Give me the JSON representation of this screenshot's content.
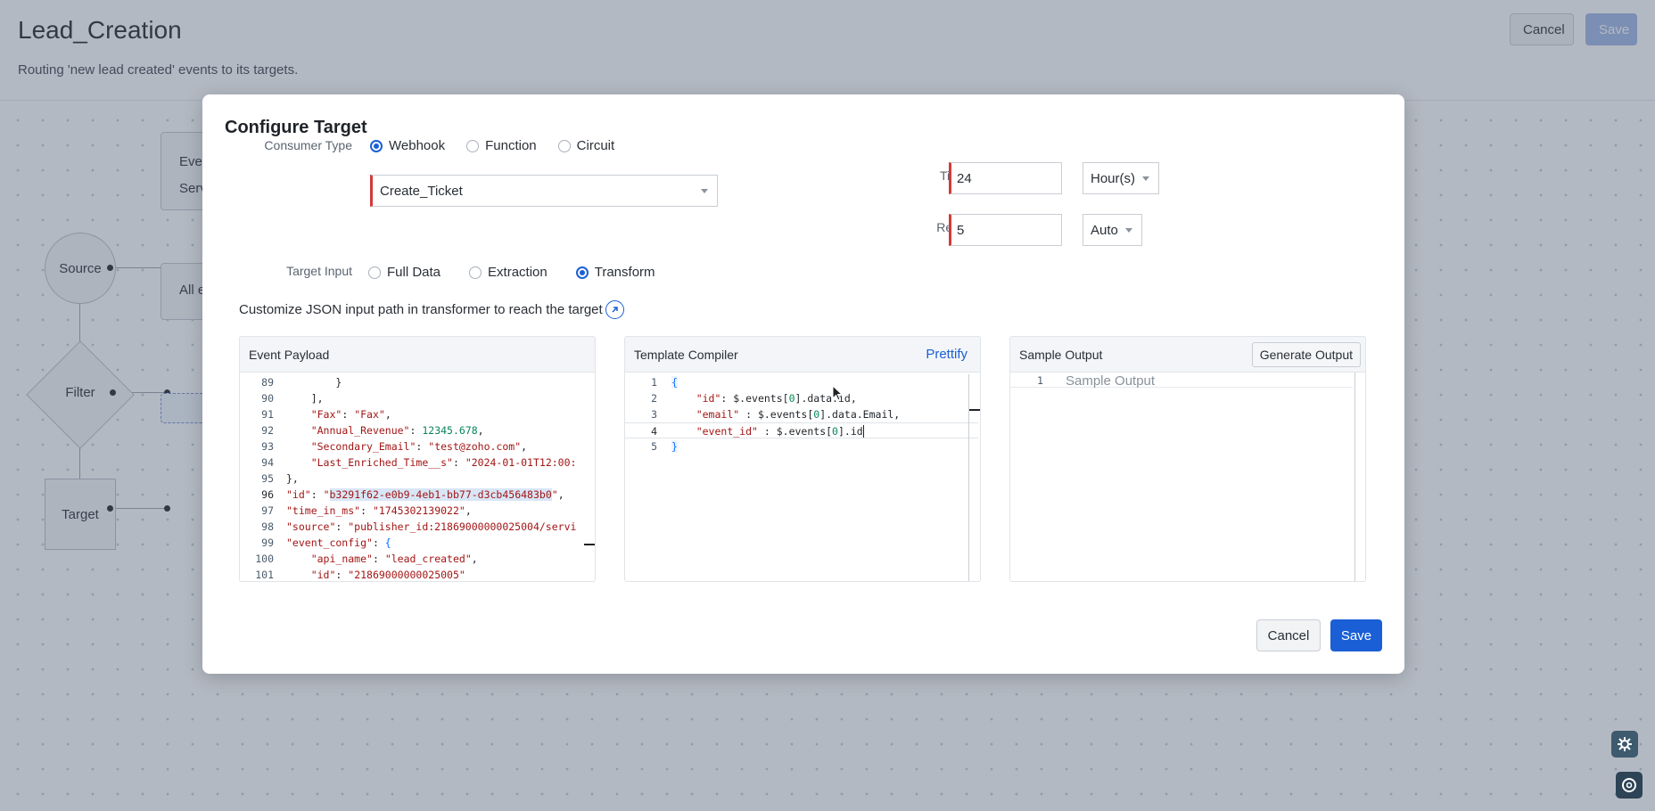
{
  "page": {
    "title": "Lead_Creation",
    "subtitle": "Routing 'new lead created' events to its targets.",
    "cancel_label": "Cancel",
    "save_label": "Save"
  },
  "flow": {
    "source_label": "Source",
    "filter_label": "Filter",
    "target_label": "Target",
    "event_card_line1": "Eve",
    "event_card_line2": "Serv",
    "filter_card_text": "All e"
  },
  "modal": {
    "title": "Configure Target",
    "consumer_type_label": "Consumer Type",
    "consumer_types": [
      "Webhook",
      "Function",
      "Circuit"
    ],
    "consumer_selected": "Webhook",
    "webhook_value": "Create_Ticket",
    "time_to_live_label": "Time to live",
    "time_to_live_value": "24",
    "time_to_live_unit": "Hour(s)",
    "retry_count_label": "Retry Count",
    "retry_count_value": "5",
    "retry_mode": "Auto",
    "target_input_label": "Target Input",
    "target_inputs": [
      "Full Data",
      "Extraction",
      "Transform"
    ],
    "target_input_selected": "Transform",
    "hint": "Customize JSON input path in transformer to reach the target",
    "panels": {
      "payload_title": "Event Payload",
      "compiler_title": "Template Compiler",
      "prettify_label": "Prettify",
      "output_title": "Sample Output",
      "generate_label": "Generate Output",
      "output_placeholder": "Sample Output"
    },
    "cancel_label": "Cancel",
    "save_label": "Save"
  },
  "payload_lines": [
    {
      "n": "89",
      "t": "        }"
    },
    {
      "n": "90",
      "t": "    ],"
    },
    {
      "n": "91",
      "t": "    \"Fax\": \"Fax\","
    },
    {
      "n": "92",
      "t": "    \"Annual_Revenue\": 12345.678,"
    },
    {
      "n": "93",
      "t": "    \"Secondary_Email\": \"test@zoho.com\","
    },
    {
      "n": "94",
      "t": "    \"Last_Enriched_Time__s\": \"2024-01-01T12:00:"
    },
    {
      "n": "95",
      "t": "},"
    },
    {
      "n": "96",
      "t": "\"id\": \"b3291f62-e0b9-4eb1-bb77-d3cb456483b0\","
    },
    {
      "n": "97",
      "t": "\"time_in_ms\": \"1745302139022\","
    },
    {
      "n": "98",
      "t": "\"source\": \"publisher_id:21869000000025004/servi"
    },
    {
      "n": "99",
      "t": "\"event_config\": {"
    },
    {
      "n": "100",
      "t": "    \"api_name\": \"lead_created\","
    },
    {
      "n": "101",
      "t": "    \"id\": \"21869000000025005\""
    }
  ],
  "template_lines": [
    {
      "n": "1",
      "t": "{"
    },
    {
      "n": "2",
      "t": "    \"id\": $.events[0].data.id,"
    },
    {
      "n": "3",
      "t": "    \"email\" : $.events[0].data.Email,"
    },
    {
      "n": "4",
      "t": "    \"event_id\" : $.events[0].id"
    },
    {
      "n": "5",
      "t": "}"
    }
  ],
  "output_line_number": "1",
  "colors": {
    "accent": "#1a5fd6",
    "required": "#d33a3a",
    "json_key": "#a31515",
    "json_number": "#098658"
  }
}
